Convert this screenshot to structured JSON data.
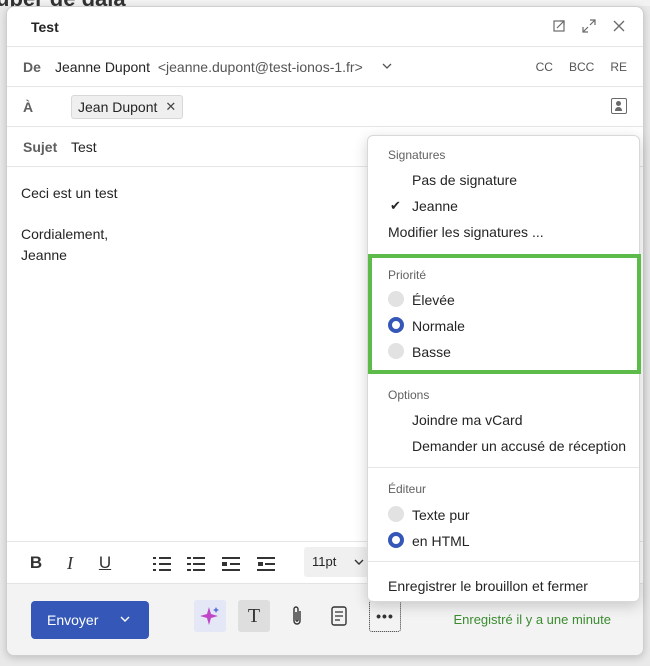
{
  "background": {
    "text": "uper de gala"
  },
  "window": {
    "title": "Test"
  },
  "from": {
    "label": "De",
    "name": "Jeanne Dupont",
    "email": "<jeanne.dupont@test-ionos-1.fr>",
    "cc": "CC",
    "bcc": "BCC",
    "re": "RE"
  },
  "to": {
    "label": "À",
    "recipient": "Jean Dupont"
  },
  "subject": {
    "label": "Sujet",
    "value": "Test"
  },
  "body": {
    "line1": "Ceci est un test",
    "line2": "Cordialement,",
    "line3": "Jeanne"
  },
  "format": {
    "bold": "B",
    "italic": "I",
    "underline": "U",
    "font_size": "11pt"
  },
  "footer": {
    "send": "Envoyer",
    "text_tool": "T",
    "more": "•••",
    "saved": "Enregistré il y a une minute"
  },
  "menu": {
    "signatures": {
      "header": "Signatures",
      "none": "Pas de signature",
      "jeanne": "Jeanne",
      "edit": "Modifier les signatures ..."
    },
    "priority": {
      "header": "Priorité",
      "high": "Élevée",
      "normal": "Normale",
      "low": "Basse",
      "selected": "Normale"
    },
    "options": {
      "header": "Options",
      "vcard": "Joindre ma vCard",
      "receipt": "Demander un accusé de réception"
    },
    "editor": {
      "header": "Éditeur",
      "plain": "Texte pur",
      "html": "en HTML",
      "selected": "en HTML"
    },
    "save_close": "Enregistrer le brouillon et fermer"
  },
  "colors": {
    "accent": "#3558b8",
    "highlight": "#5dbb4a",
    "saved": "#3a8c2f"
  }
}
